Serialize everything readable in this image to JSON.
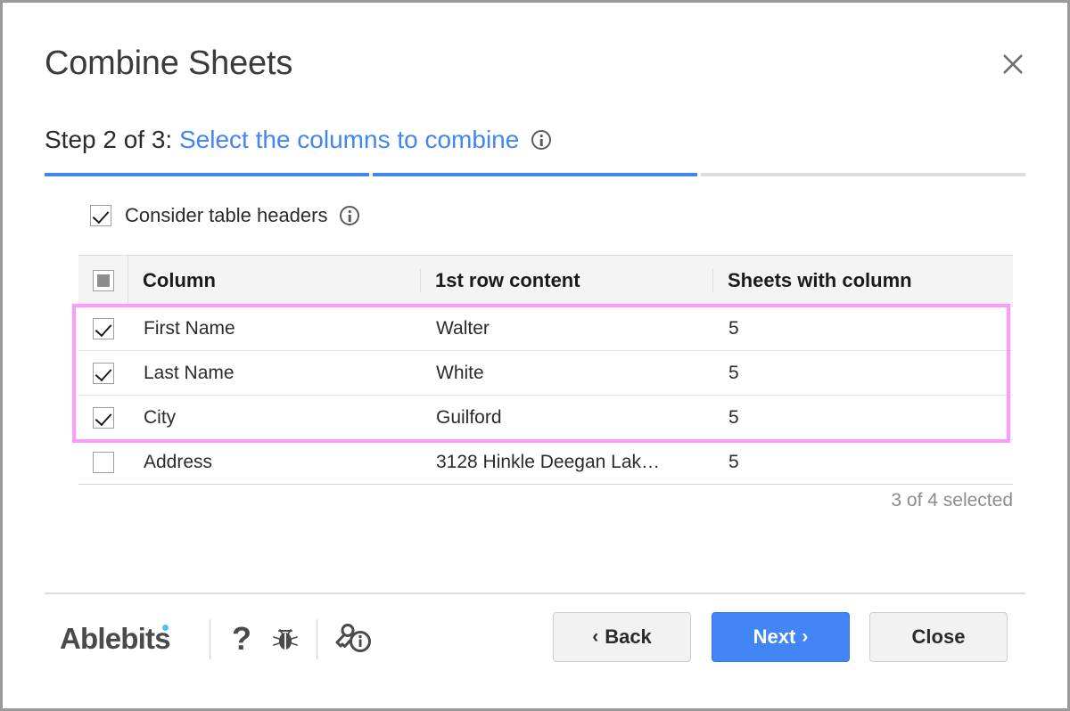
{
  "window": {
    "title": "Combine Sheets",
    "close_icon": "close-icon"
  },
  "step": {
    "prefix": "Step 2 of 3: ",
    "link": "Select the columns to combine",
    "info_icon": "info-icon",
    "current": 2,
    "total": 3,
    "segments_done": 2
  },
  "options": {
    "consider_headers_label": "Consider table headers",
    "consider_headers_checked": true,
    "consider_headers_info_icon": "info-icon"
  },
  "table": {
    "select_all_state": "indeterminate",
    "headers": [
      "Column",
      "1st row content",
      "Sheets with column"
    ],
    "rows": [
      {
        "checked": true,
        "column": "First Name",
        "first_row_content": "Walter",
        "sheets_with_column": "5"
      },
      {
        "checked": true,
        "column": "Last Name",
        "first_row_content": "White",
        "sheets_with_column": "5"
      },
      {
        "checked": true,
        "column": "City",
        "first_row_content": "Guilford",
        "sheets_with_column": "5"
      },
      {
        "checked": false,
        "column": "Address",
        "first_row_content": "3128 Hinkle Deegan Lak…",
        "sheets_with_column": "5"
      }
    ],
    "selection_summary": "3 of 4 selected",
    "highlight_color": "#ff99ff"
  },
  "footer": {
    "brand": "Ablebits",
    "brand_dot_color": "#4cc3e8",
    "icons": [
      {
        "name": "help-icon",
        "glyph": "?"
      },
      {
        "name": "bug-icon",
        "glyph": "bug"
      },
      {
        "name": "license-info-icon",
        "glyph": "key-info"
      }
    ],
    "buttons": {
      "back": {
        "label": "Back",
        "chevron": "‹"
      },
      "next": {
        "label": "Next",
        "chevron": "›"
      },
      "close": {
        "label": "Close"
      }
    },
    "accent_color": "#4285f4"
  }
}
